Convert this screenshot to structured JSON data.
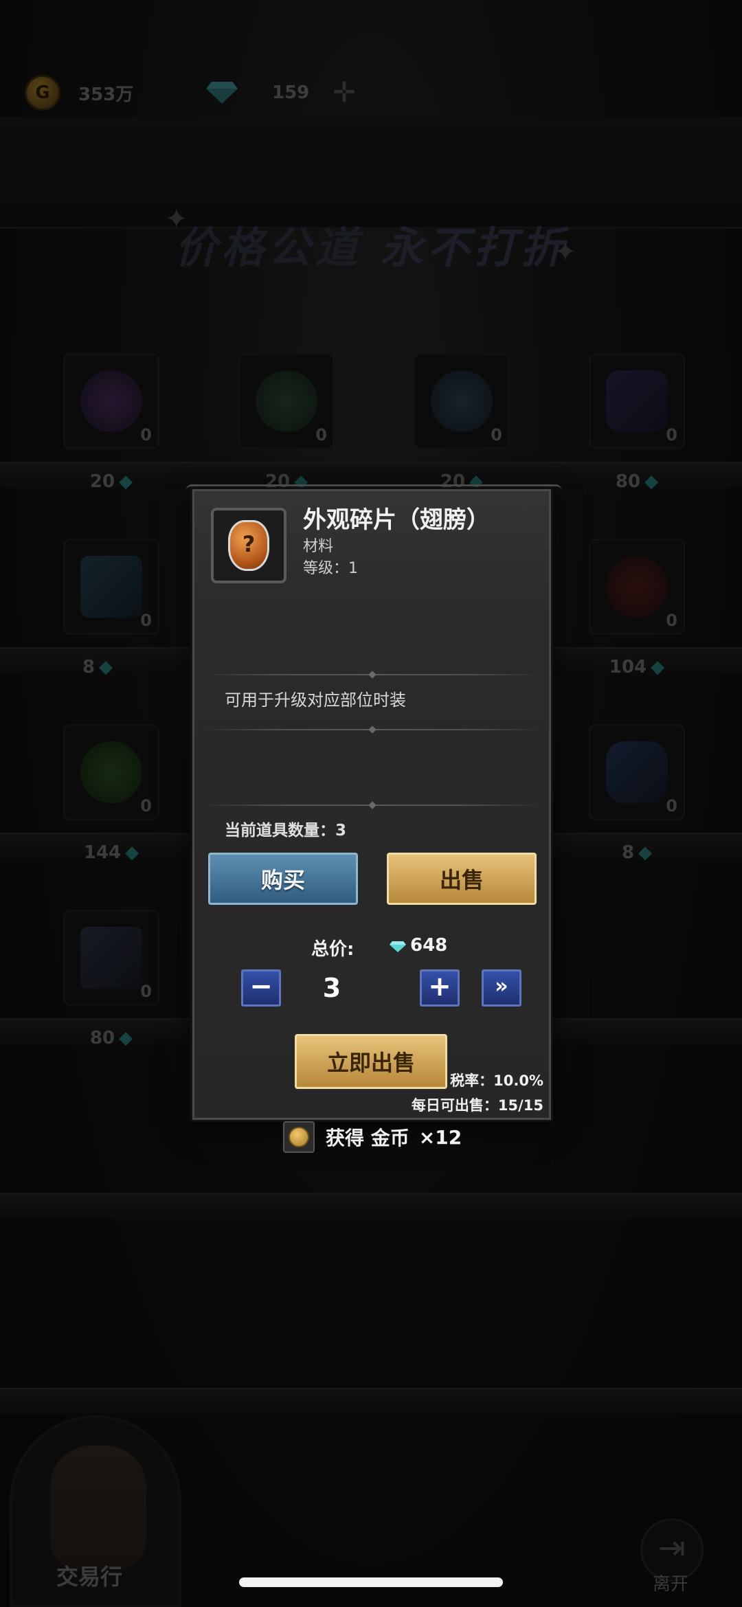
{
  "currency": {
    "gold": "353万",
    "diamonds": "159"
  },
  "shop": {
    "slogan_left": "价格公道",
    "slogan_right": "永不打折",
    "items": [
      {
        "name": "purple-orb",
        "count": "0",
        "price": "20"
      },
      {
        "name": "green-orb",
        "count": "0",
        "price": "20"
      },
      {
        "name": "blue-scroll",
        "count": "0",
        "price": "20"
      },
      {
        "name": "purple-roll",
        "count": "0",
        "price": "80"
      },
      {
        "name": "blue-book",
        "count": "0",
        "price": "8"
      },
      {
        "name": "red-fragment",
        "count": "0",
        "price": "104"
      },
      {
        "name": "green-fragment",
        "count": "0",
        "price": "144"
      },
      {
        "name": "blue-crystal",
        "count": "0",
        "price": "8"
      },
      {
        "name": "star-card",
        "count": "0",
        "price": "80"
      }
    ],
    "npc_label": "交易行",
    "exit_label": "离开"
  },
  "dialog": {
    "item_name": "外观碎片（翅膀）",
    "item_type": "材料",
    "item_level": "等级：1",
    "description": "可用于升级对应部位时装",
    "owned_quantity": "当前道具数量：3",
    "buy_label": "购买",
    "sell_label": "出售",
    "total_label": "总价:",
    "total_value": "648",
    "quantity": "3",
    "minus_symbol": "−",
    "plus_symbol": "+",
    "max_symbol": "»",
    "sell_now_label": "立即出售",
    "tax_rate": "税率：10.0%",
    "daily_limit": "每日可出售：15/15"
  },
  "reward": {
    "text": "获得 金币",
    "count": "×12"
  },
  "colors": {
    "gem": "#5fd6d6",
    "gold_button": "#d9aa55",
    "blue_button": "#3f74a0",
    "stepper": "#2a3f90"
  }
}
